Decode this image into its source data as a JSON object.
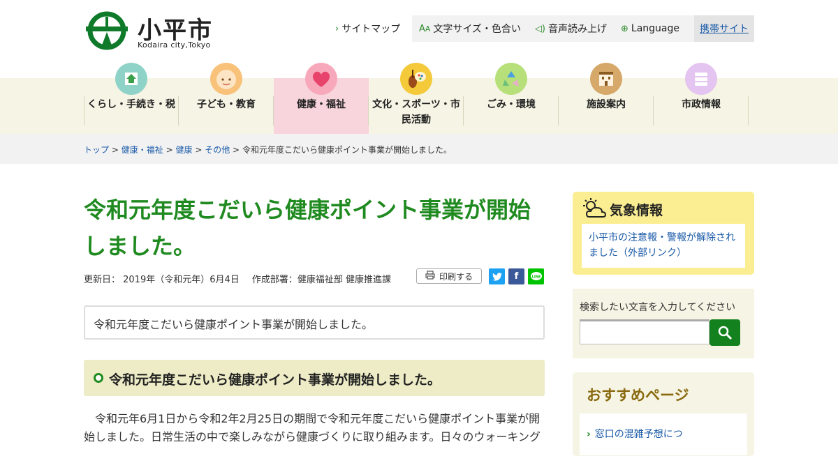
{
  "header": {
    "logo_name": "小平市",
    "logo_sub": "Kodaira city,Tokyo",
    "sitemap": "サイトマップ",
    "font_color": "文字サイズ・色合い",
    "read_aloud": "音声読み上げ",
    "language": "Language",
    "mobile": "携帯サイト"
  },
  "nav": [
    {
      "label": "くらし・手続き・税",
      "icon": "house-icon"
    },
    {
      "label": "子ども・教育",
      "icon": "child-face-icon"
    },
    {
      "label": "健康・福祉",
      "icon": "heart-icon"
    },
    {
      "label": "文化・スポーツ・市民活動",
      "icon": "violin-palette-icon"
    },
    {
      "label": "ごみ・環境",
      "icon": "recycle-icon"
    },
    {
      "label": "施設案内",
      "icon": "building-icon"
    },
    {
      "label": "市政情報",
      "icon": "document-icon"
    }
  ],
  "breadcrumb": {
    "top": "トップ",
    "cat": "健康・福祉",
    "sub": "健康",
    "other": "その他",
    "current": "令和元年度こだいら健康ポイント事業が開始しました。",
    "sep": ">"
  },
  "main": {
    "title_line1": "令和元年度こだいら健康ポイント事業が開始",
    "title_line2": "しました。",
    "updated": "更新日： 2019年（令和元年）6月4日",
    "dept": "作成部署：健康福祉部 健康推進課",
    "print": "印刷する",
    "summary": "令和元年度こだいら健康ポイント事業が開始しました。",
    "heading": "令和元年度こだいら健康ポイント事業が開始しました。",
    "body": "　令和元年6月1日から令和2年2月25日の期間で令和元年度こだいら健康ポイント事業が開始しました。日常生活の中で楽しみながら健康づくりに取り組みます。日々のウォーキング"
  },
  "sidebar": {
    "weather_title": "気象情報",
    "weather_link": "小平市の注意報・警報が解除されました（外部リンク）",
    "search_label": "検索したい文言を入力してください",
    "search_placeholder": "",
    "recommend_title": "おすすめページ",
    "recommend_item": "窓口の混雑予想につ"
  },
  "colors": {
    "brand_green": "#1f8a1f",
    "nav_active": "#f8d4dd",
    "link": "#1a5aa8",
    "weather_bg": "#fbee92"
  }
}
